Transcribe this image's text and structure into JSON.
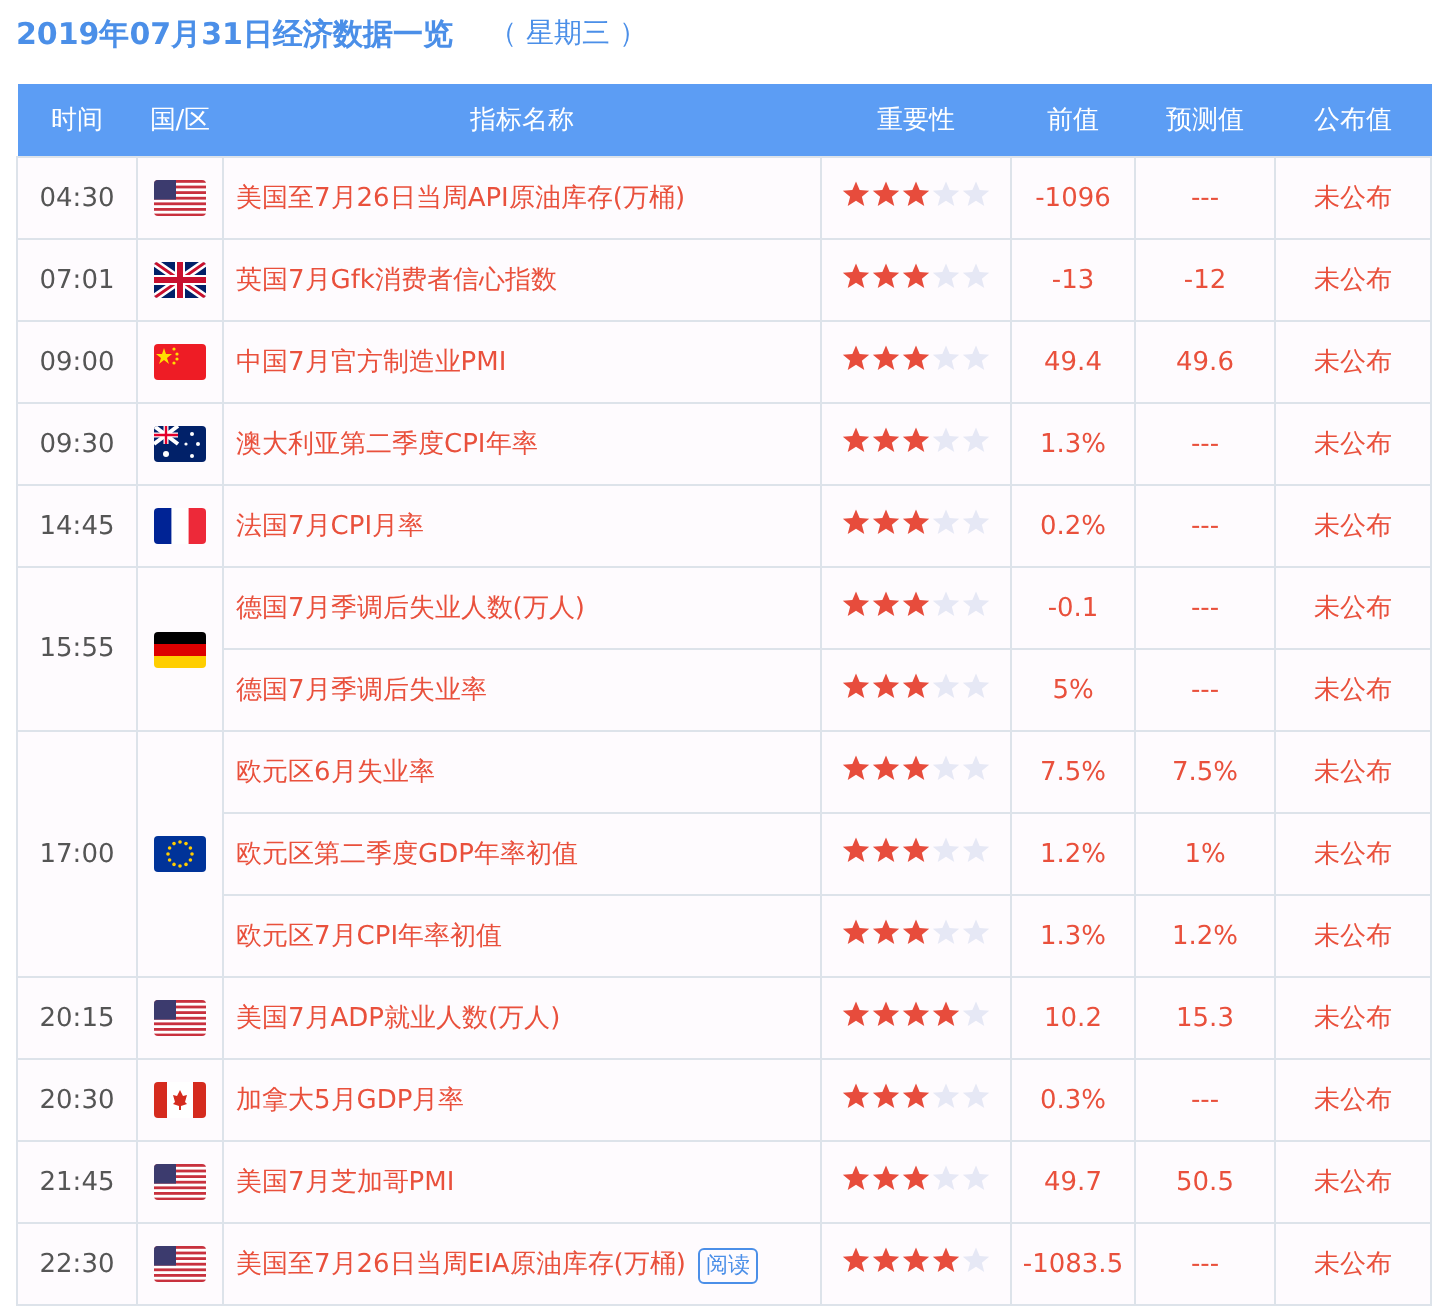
{
  "title": "2019年07月31日经济数据一览",
  "weekday": "（ 星期三 ）",
  "columns": [
    "时间",
    "国/区",
    "指标名称",
    "重要性",
    "前值",
    "预测值",
    "公布值"
  ],
  "groups": [
    {
      "time": "04:30",
      "kind": "us",
      "events": [
        {
          "name": "美国至7月26日当周API原油库存(万桶)",
          "stars": 3,
          "previous": "-1096",
          "forecast": "---",
          "actual": "未公布"
        }
      ]
    },
    {
      "time": "07:01",
      "kind": "uk",
      "events": [
        {
          "name": "英国7月Gfk消费者信心指数",
          "stars": 3,
          "previous": "-13",
          "forecast": "-12",
          "actual": "未公布"
        }
      ]
    },
    {
      "time": "09:00",
      "kind": "cn",
      "events": [
        {
          "name": "中国7月官方制造业PMI",
          "stars": 3,
          "previous": "49.4",
          "forecast": "49.6",
          "actual": "未公布"
        }
      ]
    },
    {
      "time": "09:30",
      "kind": "au",
      "events": [
        {
          "name": "澳大利亚第二季度CPI年率",
          "stars": 3,
          "previous": "1.3%",
          "forecast": "---",
          "actual": "未公布"
        }
      ]
    },
    {
      "time": "14:45",
      "kind": "fr",
      "events": [
        {
          "name": "法国7月CPI月率",
          "stars": 3,
          "previous": "0.2%",
          "forecast": "---",
          "actual": "未公布"
        }
      ]
    },
    {
      "time": "15:55",
      "kind": "de",
      "events": [
        {
          "name": "德国7月季调后失业人数(万人)",
          "stars": 3,
          "previous": "-0.1",
          "forecast": "---",
          "actual": "未公布"
        },
        {
          "name": "德国7月季调后失业率",
          "stars": 3,
          "previous": "5%",
          "forecast": "---",
          "actual": "未公布"
        }
      ]
    },
    {
      "time": "17:00",
      "kind": "eu",
      "events": [
        {
          "name": "欧元区6月失业率",
          "stars": 3,
          "previous": "7.5%",
          "forecast": "7.5%",
          "actual": "未公布"
        },
        {
          "name": "欧元区第二季度GDP年率初值",
          "stars": 3,
          "previous": "1.2%",
          "forecast": "1%",
          "actual": "未公布"
        },
        {
          "name": "欧元区7月CPI年率初值",
          "stars": 3,
          "previous": "1.3%",
          "forecast": "1.2%",
          "actual": "未公布"
        }
      ]
    },
    {
      "time": "20:15",
      "kind": "us",
      "events": [
        {
          "name": "美国7月ADP就业人数(万人)",
          "stars": 4,
          "previous": "10.2",
          "forecast": "15.3",
          "actual": "未公布"
        }
      ]
    },
    {
      "time": "20:30",
      "kind": "ca",
      "events": [
        {
          "name": "加拿大5月GDP月率",
          "stars": 3,
          "previous": "0.3%",
          "forecast": "---",
          "actual": "未公布"
        }
      ]
    },
    {
      "time": "21:45",
      "kind": "us",
      "events": [
        {
          "name": "美国7月芝加哥PMI",
          "stars": 3,
          "previous": "49.7",
          "forecast": "50.5",
          "actual": "未公布"
        }
      ]
    },
    {
      "time": "22:30",
      "kind": "us",
      "events": [
        {
          "name": "美国至7月26日当周EIA原油库存(万桶)",
          "badge": "阅读",
          "stars": 4,
          "previous": "-1083.5",
          "forecast": "---",
          "actual": "未公布"
        }
      ]
    }
  ]
}
